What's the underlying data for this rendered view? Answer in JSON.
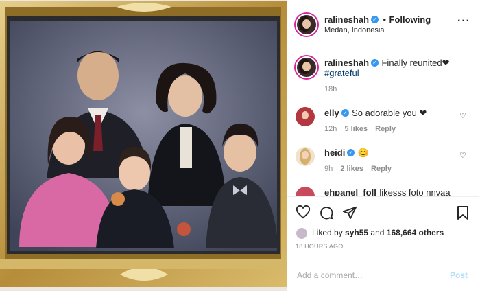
{
  "header": {
    "username": "ralineshah",
    "separator": "•",
    "follow_status": "Following",
    "location": "Medan, Indonesia",
    "more_icon": "more-horizontal-icon"
  },
  "caption": {
    "username": "ralineshah",
    "text": "Finally reunited❤",
    "hashtag": "#grateful",
    "time": "18h"
  },
  "comments": [
    {
      "username": "elly",
      "text": "So adorable you ❤",
      "time": "12h",
      "likes": "5 likes",
      "reply": "Reply"
    },
    {
      "username": "heidi",
      "text": "😊",
      "time": "9h",
      "likes": "2 likes",
      "reply": "Reply"
    },
    {
      "username": "ehpanel_foll",
      "text": "likesss foto nnyaa"
    }
  ],
  "actions": {
    "liked_by_prefix": "Liked by",
    "liked_by_user": "syh55",
    "and": "and",
    "others": "168,664 others",
    "timestamp": "18 HOURS AGO"
  },
  "add_comment": {
    "placeholder": "Add a comment…",
    "post_label": "Post"
  },
  "colors": {
    "verified": "#3897f0",
    "link": "#00376b",
    "post_disabled": "#b2dffc",
    "gold_frame": "#c9a64f"
  }
}
